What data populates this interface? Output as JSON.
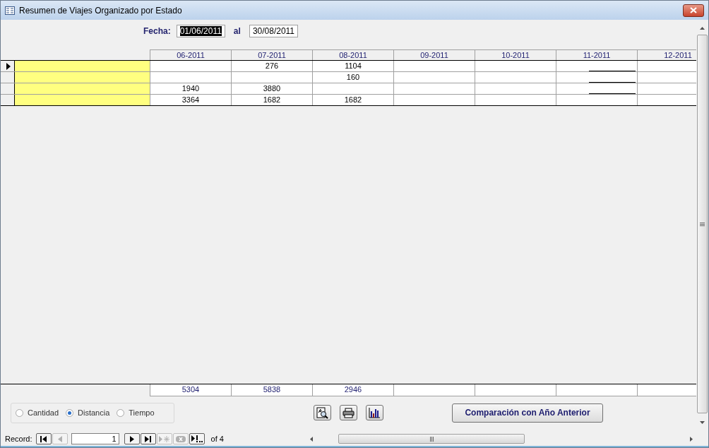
{
  "window": {
    "title": "Resumen de Viajes Organizado por Estado"
  },
  "date_range": {
    "from_label": "Fecha:",
    "from": {
      "value": "01/06/2011",
      "selected": true
    },
    "to_label": "al",
    "to": {
      "value": "30/08/2011",
      "selected": false
    }
  },
  "table": {
    "columns": [
      "06-2011",
      "07-2011",
      "08-2011",
      "09-2011",
      "10-2011",
      "11-2011",
      "12-2011"
    ],
    "rows": [
      {
        "selected": true,
        "cells": [
          {
            "underline": false
          },
          {
            "text": "276",
            "underline": false
          },
          {
            "text": "1104",
            "underline": false
          },
          {
            "underline": false
          },
          {
            "underline": false
          },
          {
            "underline": true
          },
          {
            "underline": false
          }
        ]
      },
      {
        "selected": false,
        "cells": [
          {
            "underline": false
          },
          {
            "underline": false
          },
          {
            "text": "160",
            "underline": false
          },
          {
            "underline": false
          },
          {
            "underline": false
          },
          {
            "underline": true
          },
          {
            "underline": false
          }
        ]
      },
      {
        "selected": false,
        "cells": [
          {
            "text": "1940",
            "underline": false
          },
          {
            "text": "3880",
            "underline": false
          },
          {
            "underline": false
          },
          {
            "underline": false
          },
          {
            "underline": false
          },
          {
            "underline": true
          },
          {
            "underline": false
          }
        ]
      },
      {
        "selected": false,
        "cells": [
          {
            "text": "3364",
            "underline": false
          },
          {
            "text": "1682",
            "underline": false
          },
          {
            "text": "1682",
            "underline": false
          },
          {
            "underline": false
          },
          {
            "underline": false
          },
          {
            "underline": false
          },
          {
            "underline": false
          }
        ]
      }
    ],
    "totals": [
      "5304",
      "5838",
      "2946"
    ]
  },
  "measure_options": [
    {
      "label": "Cantidad",
      "selected": false
    },
    {
      "label": "Distancia",
      "selected": true
    },
    {
      "label": "Tiempo",
      "selected": false
    }
  ],
  "tool_buttons": [
    {
      "kind": "preview"
    },
    {
      "kind": "print"
    },
    {
      "kind": "chart"
    }
  ],
  "compare_button": "Comparación con Año Anterior",
  "record_nav": {
    "label": "Record:",
    "current": "1",
    "of": "of 4",
    "buttons": [
      {
        "kind": "first",
        "disabled": false
      },
      {
        "kind": "prev",
        "disabled": true
      },
      {
        "kind": "next",
        "disabled": false
      },
      {
        "kind": "last",
        "disabled": false
      },
      {
        "kind": "new",
        "disabled": true
      },
      {
        "kind": "delete",
        "disabled": true
      },
      {
        "kind": "search",
        "disabled": false
      }
    ]
  }
}
